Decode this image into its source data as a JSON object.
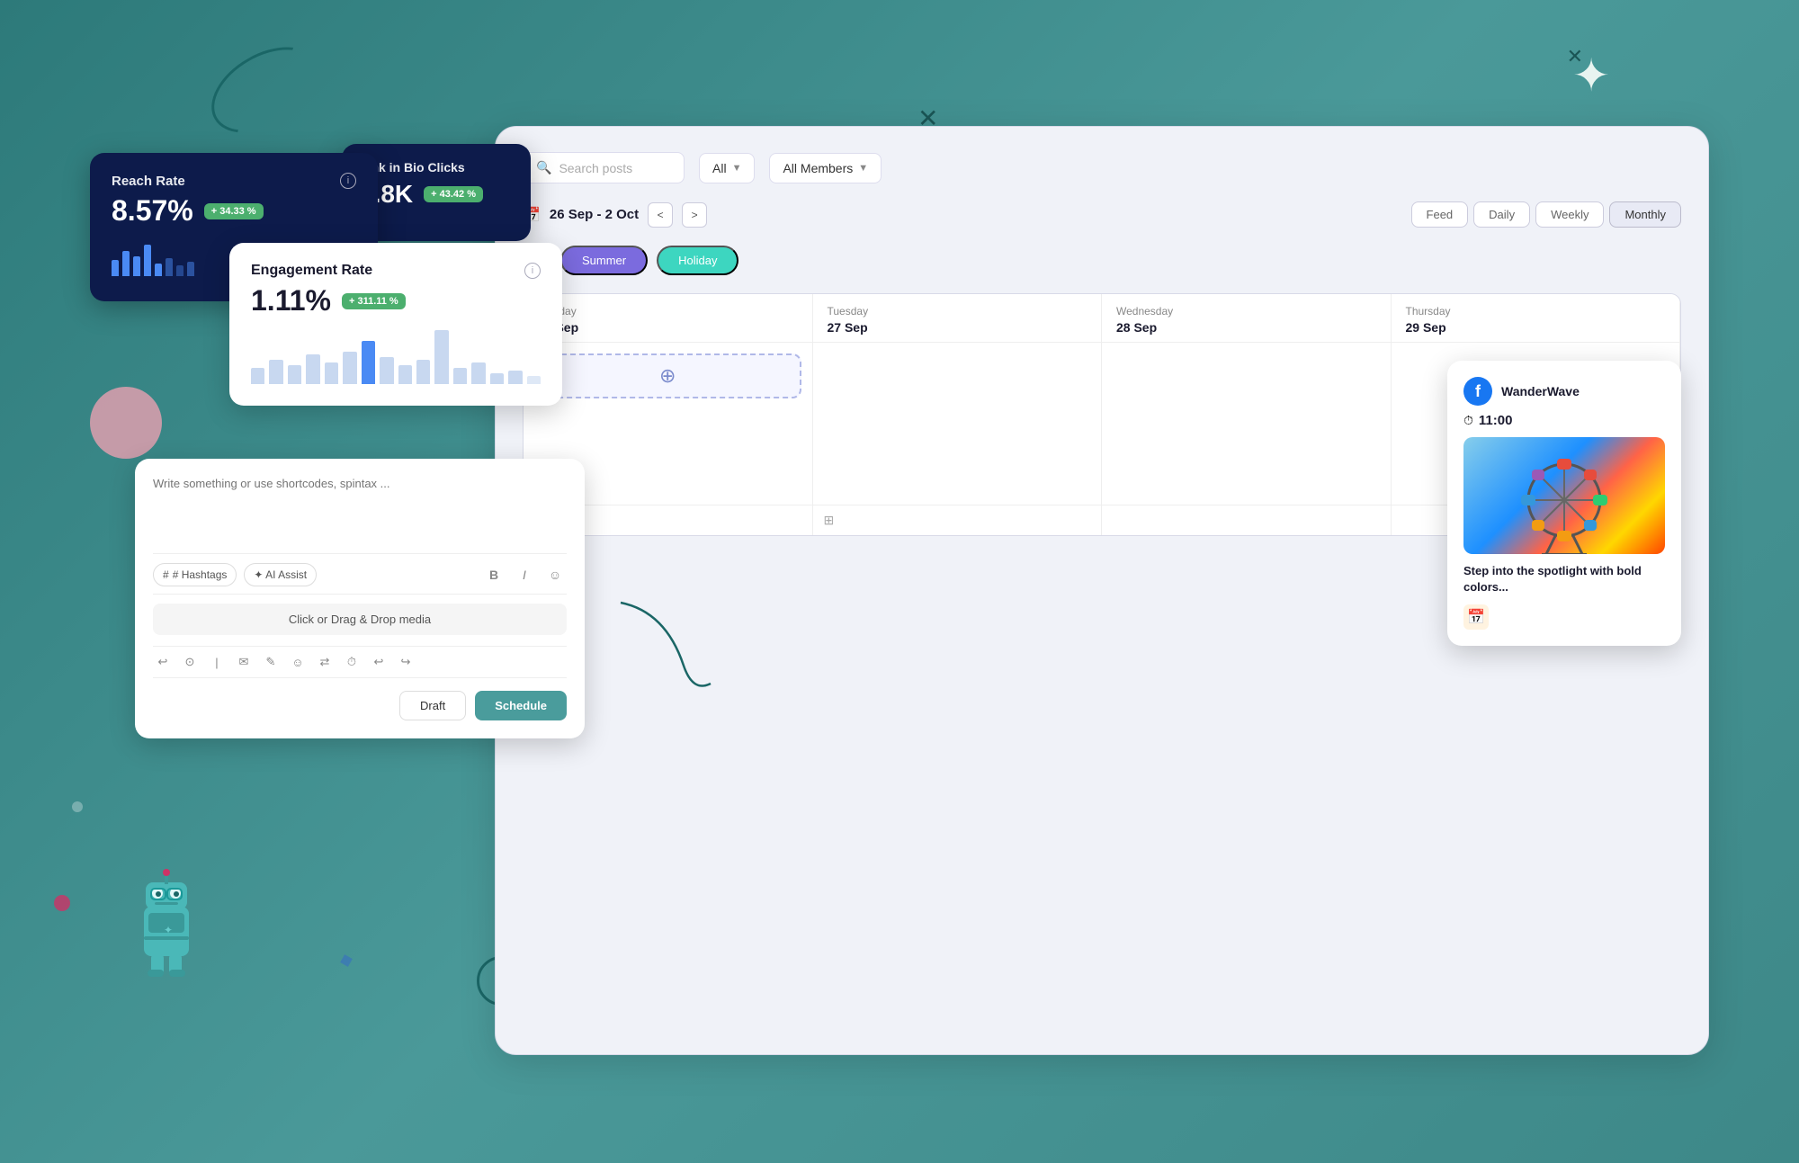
{
  "background": {
    "color": "#3a8a8a"
  },
  "reach_rate_card": {
    "title": "Reach Rate",
    "value": "8.57%",
    "badge": "+ 34.33 %",
    "info_icon": "ⓘ"
  },
  "link_bio_card": {
    "title": "Link in Bio Clicks",
    "value": "6.8K",
    "badge": "+ 43.42 %"
  },
  "engagement_card": {
    "title": "Engagement Rate",
    "value": "1.11%",
    "badge": "+ 311.11 %",
    "info_icon": "ⓘ"
  },
  "composer": {
    "placeholder": "Write something or use shortcodes, spintax ...",
    "hashtags_btn": "# Hashtags",
    "ai_assist_btn": "✦ AI Assist",
    "bold_btn": "B",
    "italic_btn": "I",
    "emoji_btn": "☺",
    "media_drop": "Click or Drag & Drop media",
    "draft_btn": "Draft",
    "schedule_btn": "Schedule"
  },
  "calendar": {
    "search_placeholder": "Search posts",
    "filter_all": "All",
    "filter_members": "All Members",
    "date_range": "26 Sep - 2 Oct",
    "view_buttons": [
      "Feed",
      "Daily",
      "Weekly",
      "Monthly"
    ],
    "active_view": "Monthly",
    "tags": [
      "Summer",
      "Holiday"
    ],
    "columns": [
      {
        "day": "Monday",
        "date": "26 Sep"
      },
      {
        "day": "Tuesday",
        "date": "27 Sep"
      },
      {
        "day": "Wednesday",
        "date": "28 Sep"
      },
      {
        "day": "Thursday",
        "date": "29 Sep"
      }
    ]
  },
  "post_card": {
    "platform": "WanderWave",
    "platform_icon": "f",
    "time": "11:00",
    "caption": "Step into the spotlight with bold colors..."
  }
}
